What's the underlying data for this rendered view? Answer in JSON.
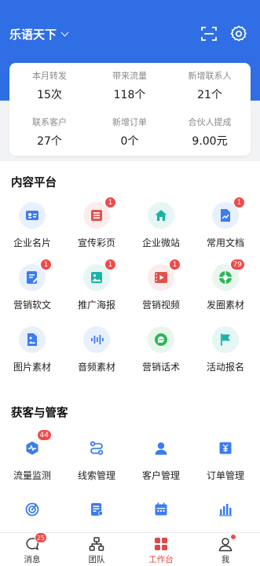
{
  "header": {
    "title": "乐语天下",
    "bg_color": "#2f6ee5",
    "actions": [
      "scan-icon",
      "settings-icon"
    ]
  },
  "stats": [
    {
      "label": "本月转发",
      "value": "15次"
    },
    {
      "label": "带来流量",
      "value": "118个"
    },
    {
      "label": "新增联系人",
      "value": "21个"
    },
    {
      "label": "联系客户",
      "value": "27个"
    },
    {
      "label": "新增订单",
      "value": "0个"
    },
    {
      "label": "合伙人提成",
      "value": "9.00元"
    }
  ],
  "content_platform": {
    "title": "内容平台",
    "items": [
      {
        "label": "企业名片",
        "icon": "business-card-icon",
        "badge": ""
      },
      {
        "label": "宣传彩页",
        "icon": "brochure-icon",
        "badge": "1"
      },
      {
        "label": "企业微站",
        "icon": "microsite-icon",
        "badge": ""
      },
      {
        "label": "常用文档",
        "icon": "document-icon",
        "badge": "1"
      },
      {
        "label": "营销软文",
        "icon": "article-icon",
        "badge": "1"
      },
      {
        "label": "推广海报",
        "icon": "poster-icon",
        "badge": "1"
      },
      {
        "label": "营销视频",
        "icon": "video-icon",
        "badge": "1"
      },
      {
        "label": "发圈素材",
        "icon": "moments-icon",
        "badge": "79"
      },
      {
        "label": "图片素材",
        "icon": "image-icon",
        "badge": ""
      },
      {
        "label": "音频素材",
        "icon": "audio-icon",
        "badge": ""
      },
      {
        "label": "营销话术",
        "icon": "script-icon",
        "badge": ""
      },
      {
        "label": "活动报名",
        "icon": "flag-icon",
        "badge": ""
      }
    ]
  },
  "acquisition": {
    "title": "获客与管客",
    "items": [
      {
        "label": "流量监测",
        "icon": "monitor-icon",
        "badge": "44"
      },
      {
        "label": "线索管理",
        "icon": "clue-icon",
        "badge": ""
      },
      {
        "label": "客户管理",
        "icon": "customer-icon",
        "badge": ""
      },
      {
        "label": "订单管理",
        "icon": "order-icon",
        "badge": ""
      }
    ],
    "partial_icons": [
      "target-icon",
      "list-icon",
      "calendar-icon",
      "bar-chart-icon"
    ]
  },
  "tabbar": [
    {
      "label": "消息",
      "icon": "message-icon",
      "badge": "25",
      "active": false
    },
    {
      "label": "团队",
      "icon": "team-icon",
      "badge": "",
      "active": false
    },
    {
      "label": "工作台",
      "icon": "workbench-icon",
      "badge": "",
      "active": true
    },
    {
      "label": "我",
      "icon": "profile-icon",
      "badge": "",
      "active": false
    }
  ],
  "colors": {
    "accent": "#2f6ee5",
    "badge": "#ef4a4a",
    "active_tab": "#e04848"
  }
}
